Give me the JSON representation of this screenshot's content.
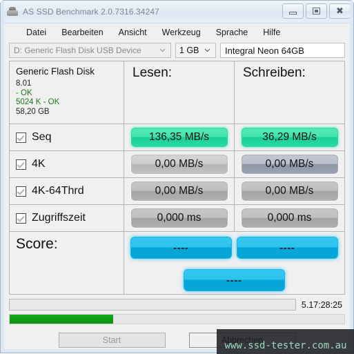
{
  "window": {
    "title": "AS SSD Benchmark 2.0.7316.34247",
    "icon": "hard-drive-icon",
    "controls": {
      "minimize": "Minimieren",
      "maximize": "Maximieren",
      "close": "Schließen"
    }
  },
  "menu": {
    "items": [
      {
        "label": "Datei"
      },
      {
        "label": "Bearbeiten"
      },
      {
        "label": "Ansicht"
      },
      {
        "label": "Werkzeug"
      },
      {
        "label": "Sprache"
      },
      {
        "label": "Hilfe"
      }
    ]
  },
  "toolbar": {
    "drive_select": {
      "value": "D: Generic Flash Disk USB Device",
      "icon": "chevron-down-icon"
    },
    "size_select": {
      "value": "1 GB",
      "icon": "chevron-down-icon"
    },
    "name_input": {
      "value": "Integral Neon 64GB",
      "placeholder": ""
    }
  },
  "info": {
    "device_name": "Generic Flash Disk",
    "firmware": "8.01",
    "alignment": " - OK",
    "block_status": "5024 K - OK",
    "capacity": "58,20 GB"
  },
  "columns": {
    "read": "Lesen:",
    "write": "Schreiben:"
  },
  "rows": [
    {
      "label": "Seq",
      "checked": true,
      "read": "136,35 MB/s",
      "write": "36,29 MB/s",
      "read_style": "green",
      "write_style": "green"
    },
    {
      "label": "4K",
      "checked": true,
      "read": "0,00 MB/s",
      "write": "0,00 MB/s",
      "read_style": "gray",
      "write_style": "gray-blue"
    },
    {
      "label": "4K-64Thrd",
      "checked": true,
      "read": "0,00 MB/s",
      "write": "0,00 MB/s",
      "read_style": "gray-dark",
      "write_style": "gray-dark"
    },
    {
      "label": "Zugriffszeit",
      "checked": true,
      "read": "0,000 ms",
      "write": "0,000 ms",
      "read_style": "gray-dark",
      "write_style": "gray-dark"
    }
  ],
  "score": {
    "title": "Score:",
    "read": "----",
    "write": "----",
    "total": "----"
  },
  "status": {
    "message": "",
    "elapsed": "5.17:28:25",
    "progress_percent": 31
  },
  "footer": {
    "start_button": "Start",
    "cancel_button": "Abbrechen"
  },
  "watermark": {
    "text": "www.ssd-tester.com.au"
  },
  "colors": {
    "accent_green": "#2ad9a4",
    "accent_cyan": "#07a6d8",
    "progress_green": "#17a81a",
    "ok_text": "#1a7a1a"
  }
}
